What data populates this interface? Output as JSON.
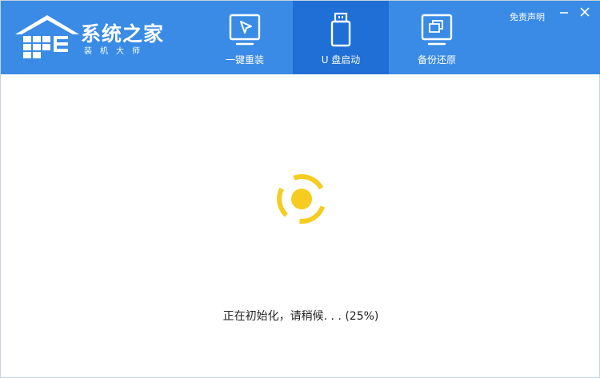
{
  "header": {
    "logo_title": "系统之家",
    "logo_subtitle": "装机大师",
    "disclaimer_label": "免责声明"
  },
  "tabs": [
    {
      "label": "一键重装",
      "icon": "cursor-arrow-monitor-icon",
      "active": false
    },
    {
      "label": "U 盘启动",
      "icon": "usb-drive-icon",
      "active": true
    },
    {
      "label": "备份还原",
      "icon": "copy-windows-icon",
      "active": false
    }
  ],
  "main": {
    "status_text": "正在初始化，请稍候. . . (25%)",
    "progress_percent": 25
  },
  "colors": {
    "header_bg": "#3a8be6",
    "active_tab_bg": "#1f6fd6",
    "spinner": "#f5cc1f"
  }
}
